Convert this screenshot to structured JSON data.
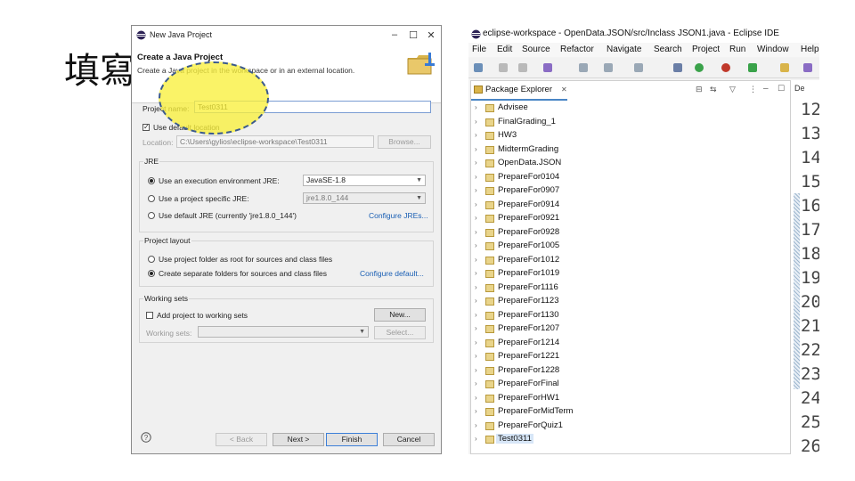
{
  "slide": {
    "title": "填寫"
  },
  "dialog": {
    "window_title": "New Java Project",
    "header_title": "Create a Java Project",
    "header_desc": "Create a Java project in the workspace or in an external location.",
    "project_name_label": "Project name:",
    "project_name_value": "Test0311",
    "use_default_location_label": "Use default location",
    "location_label": "Location:",
    "location_value": "C:\\Users\\gylios\\eclipse-workspace\\Test0311",
    "browse_label": "Browse...",
    "jre": {
      "group_title": "JRE",
      "opt_env_label": "Use an execution environment JRE:",
      "opt_env_value": "JavaSE-1.8",
      "opt_specific_label": "Use a project specific JRE:",
      "opt_specific_value": "jre1.8.0_144",
      "opt_default_label": "Use default JRE (currently 'jre1.8.0_144')",
      "configure_link": "Configure JREs..."
    },
    "layout": {
      "group_title": "Project layout",
      "opt_root_label": "Use project folder as root for sources and class files",
      "opt_separate_label": "Create separate folders for sources and class files",
      "configure_link": "Configure default..."
    },
    "working_sets": {
      "group_title": "Working sets",
      "add_label": "Add project to working sets",
      "new_label": "New...",
      "sets_label": "Working sets:",
      "select_label": "Select..."
    },
    "buttons": {
      "back": "< Back",
      "next": "Next >",
      "finish": "Finish",
      "cancel": "Cancel"
    }
  },
  "ide": {
    "window_title": "eclipse-workspace - OpenData.JSON/src/Inclass JSON1.java - Eclipse IDE",
    "menu": [
      "File",
      "Edit",
      "Source",
      "Refactor",
      "Navigate",
      "Search",
      "Project",
      "Run",
      "Window",
      "Help"
    ],
    "package_explorer_title": "Package Explorer",
    "editor_tab": "De",
    "projects": [
      "Advisee",
      "FinalGrading_1",
      "HW3",
      "MidtermGrading",
      "OpenData.JSON",
      "PrepareFor0104",
      "PrepareFor0907",
      "PrepareFor0914",
      "PrepareFor0921",
      "PrepareFor0928",
      "PrepareFor1005",
      "PrepareFor1012",
      "PrepareFor1019",
      "PrepareFor1116",
      "PrepareFor1123",
      "PrepareFor1130",
      "PrepareFor1207",
      "PrepareFor1214",
      "PrepareFor1221",
      "PrepareFor1228",
      "PrepareForFinal",
      "PrepareForHW1",
      "PrepareForMidTerm",
      "PrepareForQuiz1",
      "Test0311"
    ],
    "line_numbers": [
      "12",
      "13",
      "14",
      "15",
      "16",
      "17",
      "18",
      "19",
      "20",
      "21",
      "22",
      "23",
      "24",
      "25",
      "26"
    ]
  }
}
